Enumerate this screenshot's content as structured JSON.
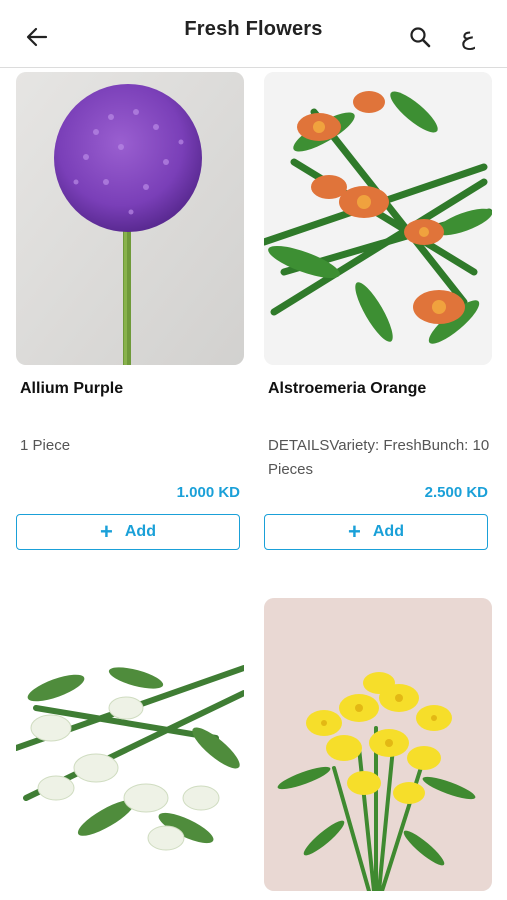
{
  "header": {
    "title": "Fresh Flowers",
    "language_toggle": "ع"
  },
  "products": [
    {
      "name": "Allium Purple",
      "description": "1 Piece",
      "price": "1.000 KD",
      "add_label": "Add"
    },
    {
      "name": "Alstroemeria Orange",
      "description": "DETAILSVariety: FreshBunch: 10 Pieces",
      "price": "2.500 KD",
      "add_label": "Add"
    }
  ],
  "colors": {
    "accent": "#1aa0d8"
  }
}
